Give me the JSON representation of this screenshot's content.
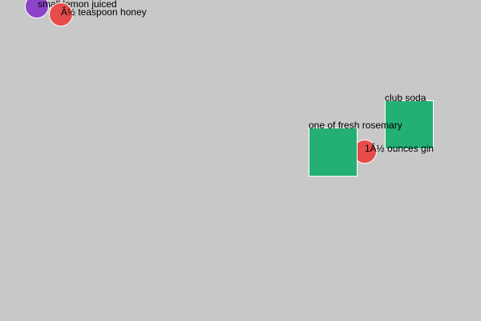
{
  "items": [
    {
      "label": "small lemon juiced",
      "shape": "circle",
      "color": "#8e44c9"
    },
    {
      "label": "Â½ teaspoon honey",
      "shape": "circle",
      "color": "#e74c4c"
    },
    {
      "label": "club soda",
      "shape": "square",
      "color": "#24b074"
    },
    {
      "label": "1Â½ ounces gin",
      "shape": "circle",
      "color": "#e74c4c"
    },
    {
      "label": "one of fresh rosemary",
      "shape": "square",
      "color": "#24b074"
    }
  ]
}
